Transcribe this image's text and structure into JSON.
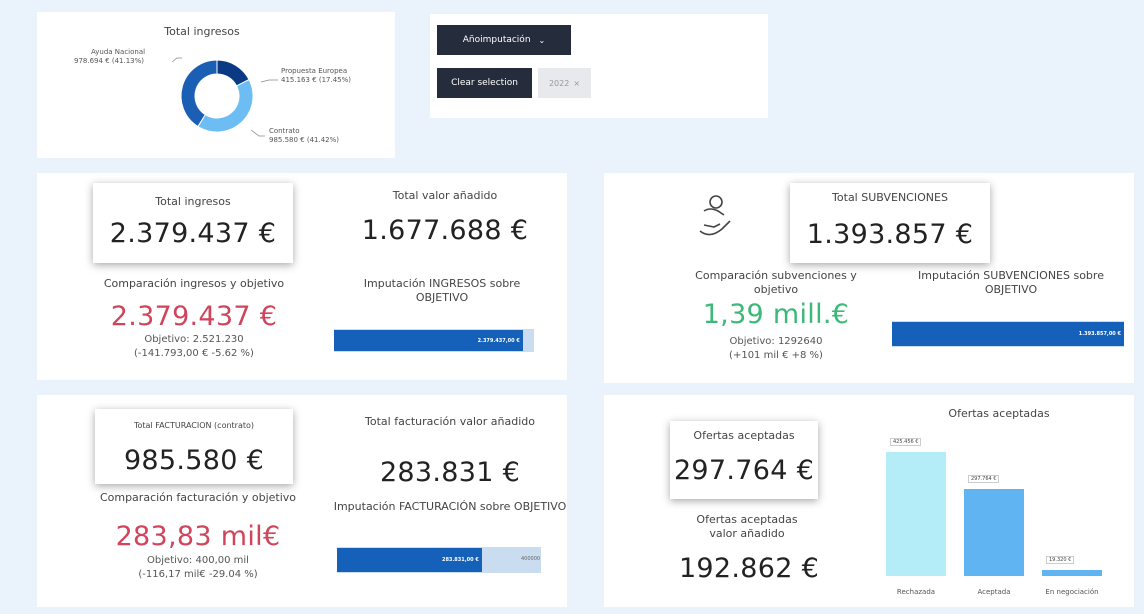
{
  "donut_card": {
    "title": "Total ingresos",
    "segments": [
      {
        "name": "Ayuda Nacional",
        "value_label": "978.694 € (41.13%)",
        "value": 978694,
        "percent": 41.13,
        "color": "#1a5fb4"
      },
      {
        "name": "Propuesta Europea",
        "value_label": "415.163 € (17.45%)",
        "value": 415163,
        "percent": 17.45,
        "color": "#0a3a84"
      },
      {
        "name": "Contrato",
        "value_label": "985.580 € (41.42%)",
        "value": 985580,
        "percent": 41.42,
        "color": "#6cbdf3"
      }
    ]
  },
  "filter_card": {
    "dropdown_label": "Añoimputación",
    "clear_label": "Clear selection",
    "chip_label": "2022",
    "chip_close": "×"
  },
  "ingresos": {
    "kpi_title": "Total ingresos",
    "kpi_value": "2.379.437 €",
    "va_title": "Total valor añadido",
    "va_value": "1.677.688 €",
    "comp_title": "Comparación ingresos y objetivo",
    "comp_value": "2.379.437 €",
    "comp_goal": "Objetivo: 2.521.230",
    "comp_diff": "(-141.793,00 € -5.62 %)",
    "gauge_title": "Imputación INGRESOS sobre OBJETIVO",
    "gauge_label": "2.379.437,00 €",
    "gauge_fraction": 0.944
  },
  "subvenciones": {
    "icon": "hand-coin-icon",
    "kpi_title": "Total SUBVENCIONES",
    "kpi_value": "1.393.857 €",
    "comp_title": "Comparación subvenciones y objetivo",
    "comp_value": "1,39 mill.€",
    "comp_goal": "Objetivo: 1292640",
    "comp_diff": "(+101 mil € +8 %)",
    "gauge_title": "Imputación SUBVENCIONES sobre OBJETIVO",
    "gauge_label": "1.393.857,00 €",
    "gauge_fraction": 1.0
  },
  "facturacion": {
    "kpi_title": "Total FACTURACION (contrato)",
    "kpi_value": "985.580 €",
    "va_title": "Total facturación valor añadido",
    "va_value": "283.831 €",
    "comp_title": "Comparación facturación y objetivo",
    "comp_value": "283,83 mil€",
    "comp_goal": "Objetivo: 400,00 mil",
    "comp_diff": "(-116,17 mil€ -29.04 %)",
    "gauge_title": "Imputación FACTURACIÓN sobre OBJETIVO",
    "gauge_label": "283.831,00 €",
    "gauge_target_label": "400000",
    "gauge_fraction": 0.71
  },
  "ofertas": {
    "kpi_title": "Ofertas aceptadas",
    "kpi_value": "297.764 €",
    "va_title": "Ofertas aceptadas valor añadido",
    "va_value": "192.862 €"
  },
  "chart_data": {
    "type": "bar",
    "title": "Ofertas aceptadas",
    "categories": [
      "Rechazada",
      "Aceptada",
      "En negociación"
    ],
    "values": [
      425456,
      297764,
      19320
    ],
    "data_labels": [
      "425.456 €",
      "297.764 €",
      "19.320 €"
    ],
    "ylim": [
      0,
      425456
    ],
    "colors": [
      "#b4ecf7",
      "#5fb4f1",
      "#5fb4f1"
    ]
  }
}
